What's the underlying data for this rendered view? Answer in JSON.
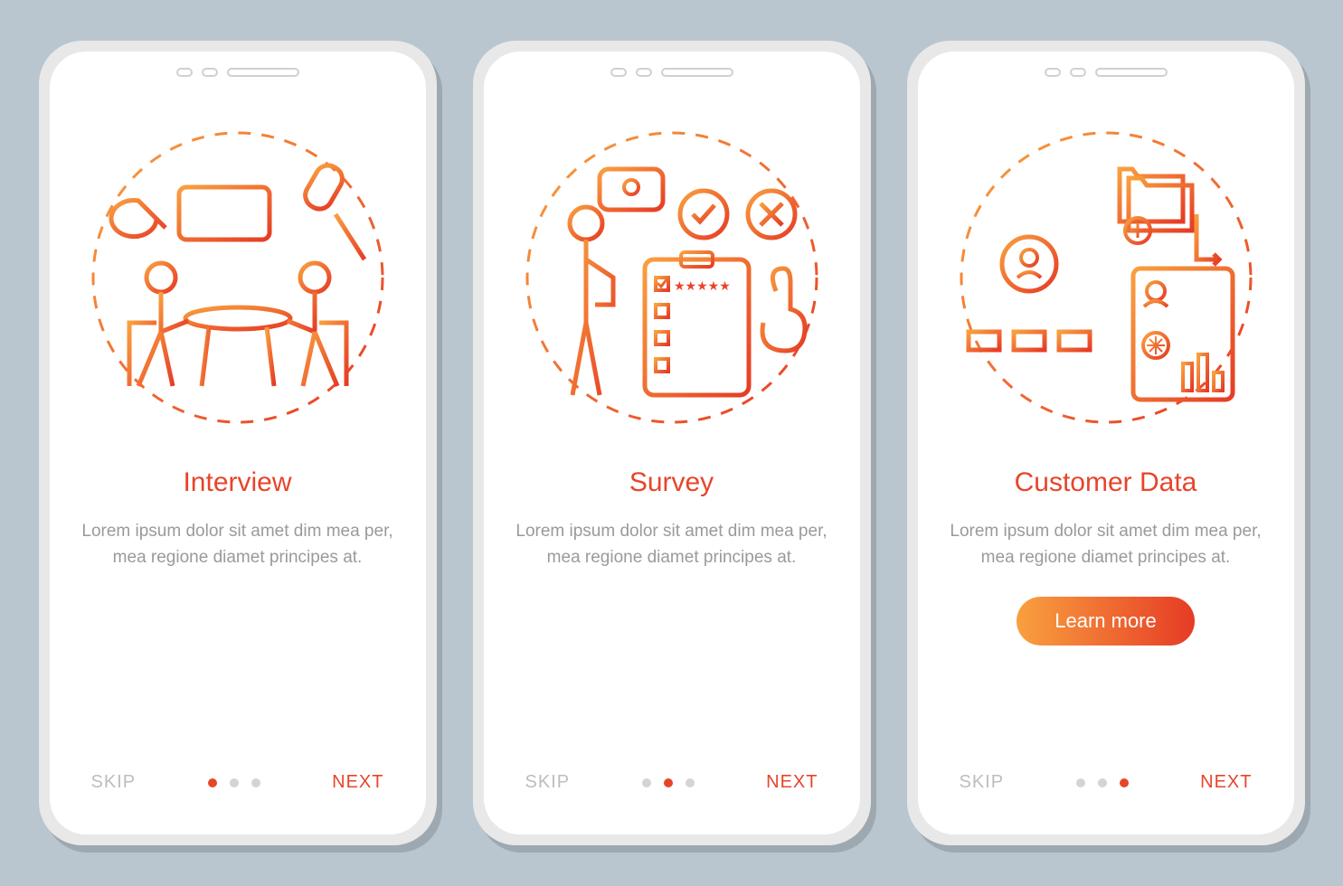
{
  "screens": [
    {
      "title": "Interview",
      "description": "Lorem ipsum dolor sit amet dim mea per, mea regione diamet principes at.",
      "skip": "SKIP",
      "next": "NEXT",
      "active_dot": 0,
      "has_cta": false
    },
    {
      "title": "Survey",
      "description": "Lorem ipsum dolor sit amet dim mea per, mea regione diamet principes at.",
      "skip": "SKIP",
      "next": "NEXT",
      "active_dot": 1,
      "has_cta": false
    },
    {
      "title": "Customer Data",
      "description": "Lorem ipsum dolor sit amet dim mea per, mea regione diamet principes at.",
      "skip": "SKIP",
      "next": "NEXT",
      "active_dot": 2,
      "has_cta": true,
      "cta_label": "Learn more"
    }
  ],
  "dot_count": 3,
  "colors": {
    "accent": "#e8442a",
    "gradient_start": "#f9a03f",
    "gradient_end": "#e63b25"
  }
}
